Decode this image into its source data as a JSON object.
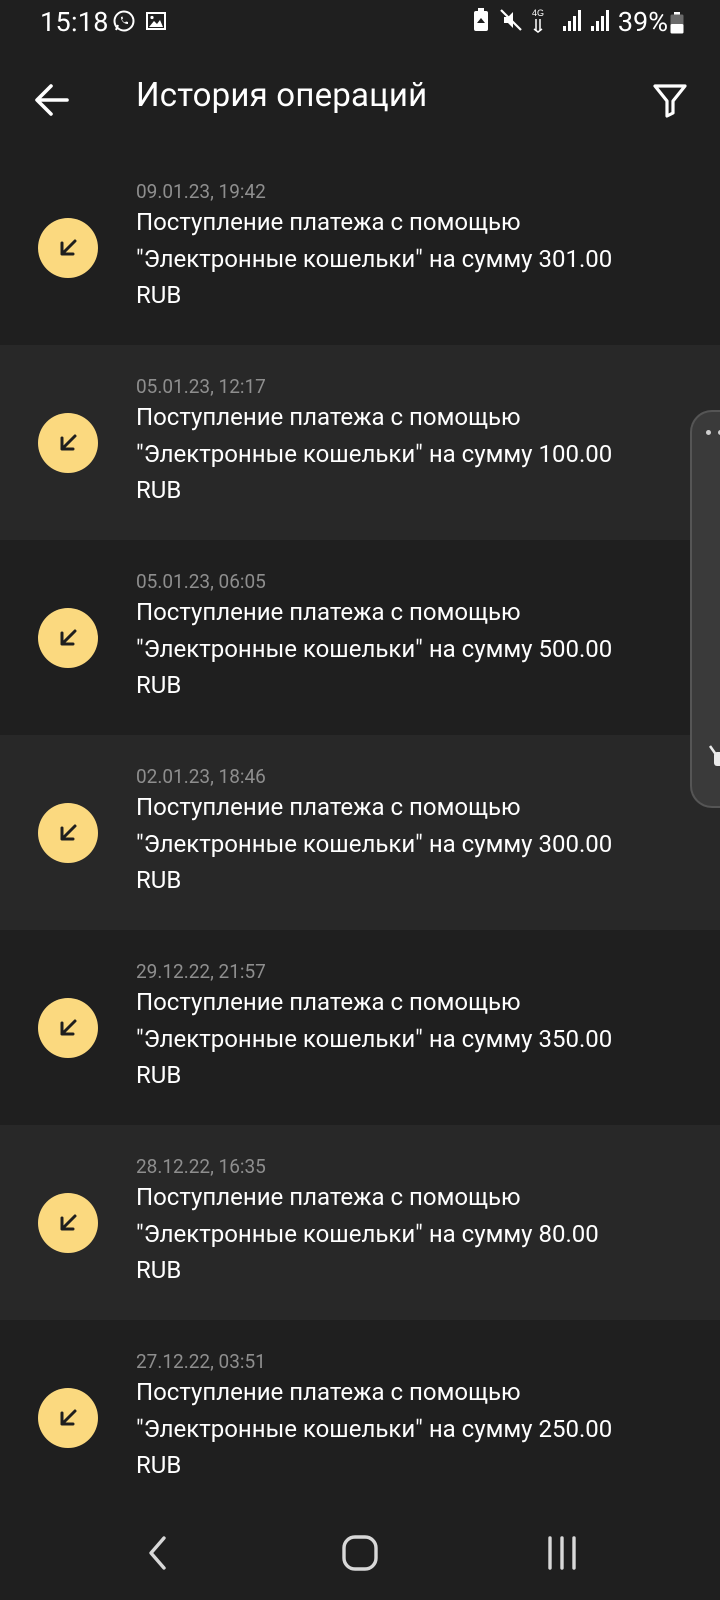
{
  "status_bar": {
    "time": "15:18",
    "battery_percent": "39%",
    "network": "4G"
  },
  "header": {
    "title": "История операций"
  },
  "operations": [
    {
      "date": "09.01.23, 19:42",
      "text": "Поступление платежа с помощью \"Электронные кошельки\" на сумму 301.00 RUB"
    },
    {
      "date": "05.01.23, 12:17",
      "text": "Поступление платежа с помощью \"Электронные кошельки\" на сумму 100.00 RUB"
    },
    {
      "date": "05.01.23, 06:05",
      "text": "Поступление платежа с помощью \"Электронные кошельки\" на сумму 500.00 RUB"
    },
    {
      "date": "02.01.23, 18:46",
      "text": "Поступление платежа с помощью \"Электронные кошельки\" на сумму 300.00 RUB"
    },
    {
      "date": "29.12.22, 21:57",
      "text": "Поступление платежа с помощью \"Электронные кошельки\" на сумму 350.00 RUB"
    },
    {
      "date": "28.12.22, 16:35",
      "text": "Поступление платежа с помощью \"Электронные кошельки\" на сумму 80.00 RUB"
    },
    {
      "date": "27.12.22, 03:51",
      "text": "Поступление платежа с помощью \"Электронные кошельки\" на сумму 250.00 RUB"
    }
  ],
  "icons": {
    "incoming": "arrow-down-left-icon",
    "back": "arrow-left-icon",
    "filter": "filter-icon"
  },
  "colors": {
    "background": "#1f1f1f",
    "row_alt": "#282828",
    "accent": "#fbd97f",
    "date_text": "#8e8e8e"
  }
}
